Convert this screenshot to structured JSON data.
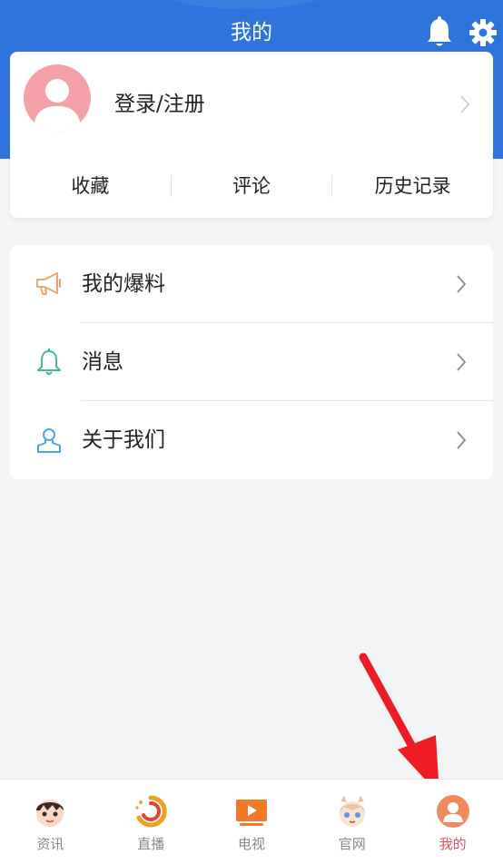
{
  "header": {
    "title": "我的"
  },
  "profile": {
    "login_label": "登录/注册",
    "stats": [
      "收藏",
      "评论",
      "历史记录"
    ]
  },
  "menu": [
    {
      "label": "我的爆料",
      "icon": "megaphone-icon",
      "color": "#f0a46c"
    },
    {
      "label": "消息",
      "icon": "bell-icon",
      "color": "#3dbd8f"
    },
    {
      "label": "关于我们",
      "icon": "user-icon",
      "color": "#4aa7e0"
    }
  ],
  "tabbar": {
    "items": [
      {
        "label": "资讯",
        "icon": "cartoon-boy-icon"
      },
      {
        "label": "直播",
        "icon": "live-swirl-icon"
      },
      {
        "label": "电视",
        "icon": "tv-play-icon"
      },
      {
        "label": "官网",
        "icon": "cartoon-girl-icon"
      },
      {
        "label": "我的",
        "icon": "person-icon",
        "active": true
      }
    ]
  },
  "colors": {
    "header_blue": "#2f74dd",
    "active_tab": "#e8525b",
    "annotation_arrow": "#ee1c25"
  }
}
